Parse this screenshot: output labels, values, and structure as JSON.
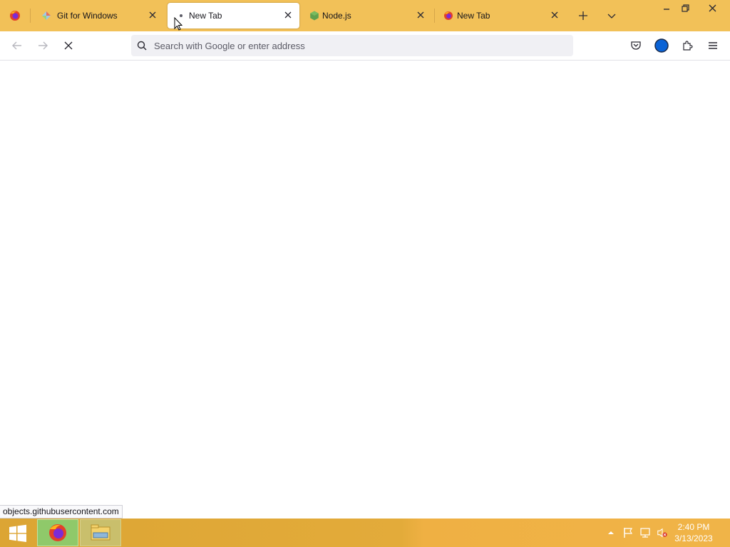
{
  "tabs": [
    {
      "title": "Git for Windows",
      "favicon": "git-for-windows-icon",
      "active": false
    },
    {
      "title": "New Tab",
      "favicon": "loading-dot-icon",
      "active": true
    },
    {
      "title": "Node.js",
      "favicon": "nodejs-icon",
      "active": false
    },
    {
      "title": "New Tab",
      "favicon": "firefox-icon",
      "active": false
    }
  ],
  "urlbar": {
    "placeholder": "Search with Google or enter address",
    "value": ""
  },
  "status": {
    "link_text": "objects.githubusercontent.com"
  },
  "clock": {
    "time": "2:40 PM",
    "date": "3/13/2023"
  },
  "colors": {
    "tabstrip": "#f2c158",
    "urlbar_bg": "#f0f0f4",
    "account_blue": "#0a63d6",
    "taskbar": "#e3ab3a"
  }
}
